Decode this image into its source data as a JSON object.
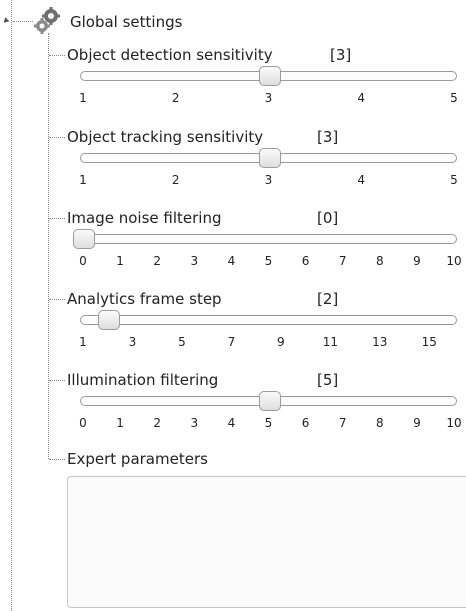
{
  "tree": {
    "root_label": "Global settings",
    "root_icon": "gears-icon",
    "expand_icon": "expanded-arrow-icon"
  },
  "settings": [
    {
      "label": "Object detection sensitivity",
      "value_text": "[3]",
      "value": 3,
      "min": 1,
      "max": 5,
      "ticks": [
        "1",
        "2",
        "3",
        "4",
        "5"
      ]
    },
    {
      "label": "Object tracking sensitivity",
      "value_text": "[3]",
      "value": 3,
      "min": 1,
      "max": 5,
      "ticks": [
        "1",
        "2",
        "3",
        "4",
        "5"
      ]
    },
    {
      "label": "Image noise filtering",
      "value_text": "[0]",
      "value": 0,
      "min": 0,
      "max": 10,
      "ticks": [
        "0",
        "1",
        "2",
        "3",
        "4",
        "5",
        "6",
        "7",
        "8",
        "9",
        "10"
      ]
    },
    {
      "label": "Analytics frame step",
      "value_text": "[2]",
      "value": 2,
      "min": 1,
      "max": 16,
      "ticks": [
        "1",
        "3",
        "5",
        "7",
        "9",
        "11",
        "13",
        "15"
      ],
      "tick_values": [
        1,
        3,
        5,
        7,
        9,
        11,
        13,
        15
      ]
    },
    {
      "label": "Illumination filtering",
      "value_text": "[5]",
      "value": 5,
      "min": 0,
      "max": 10,
      "ticks": [
        "0",
        "1",
        "2",
        "3",
        "4",
        "5",
        "6",
        "7",
        "8",
        "9",
        "10"
      ]
    }
  ],
  "expert": {
    "label": "Expert parameters",
    "value": ""
  },
  "colors": {
    "tree_line": "#8a8a8a",
    "text": "#222222",
    "track_border": "#9a9a9a",
    "thumb_border": "#9c9c9c"
  }
}
